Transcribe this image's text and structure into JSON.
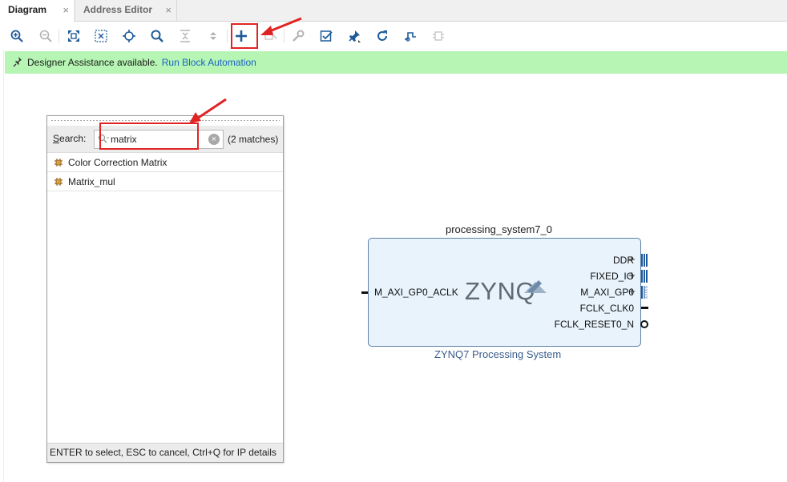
{
  "tabs": [
    {
      "label": "Diagram",
      "active": true
    },
    {
      "label": "Address Editor",
      "active": false
    }
  ],
  "tab_close_glyph": "×",
  "toolbar": {
    "buttons": [
      "zoom-in-icon",
      "zoom-out-icon",
      "fit-full-icon",
      "fit-selection-icon",
      "autofit-icon",
      "search-icon",
      "collapse-all-icon",
      "expand-all-icon",
      "add-ip-icon",
      "add-module-icon",
      "customize-icon",
      "validate-icon",
      "pin-icon",
      "regenerate-icon",
      "route-icon",
      "optimize-icon"
    ]
  },
  "assistance": {
    "message": "Designer Assistance available.",
    "link": "Run Block Automation"
  },
  "search_popup": {
    "label_prefix": "S",
    "label_rest": "earch:",
    "query": "matrix",
    "match_count": "(2 matches)",
    "results": [
      {
        "label": "Color Correction Matrix"
      },
      {
        "label": "Matrix_mul"
      }
    ],
    "footer": "ENTER to select, ESC to cancel, Ctrl+Q for IP details"
  },
  "block": {
    "instance_name": "processing_system7_0",
    "logo_text": "ZYNQ",
    "caption": "ZYNQ7 Processing System",
    "left_ports": [
      "M_AXI_GP0_ACLK"
    ],
    "right_ports": [
      "DDR",
      "FIXED_IO",
      "M_AXI_GP0",
      "FCLK_CLK0",
      "FCLK_RESET0_N"
    ]
  },
  "colors": {
    "assist_bg": "#b6f5b3",
    "link": "#1a62c7",
    "block_bg": "#e8f3fc",
    "block_border": "#5b7fa6",
    "annotation_red": "#e02424"
  }
}
